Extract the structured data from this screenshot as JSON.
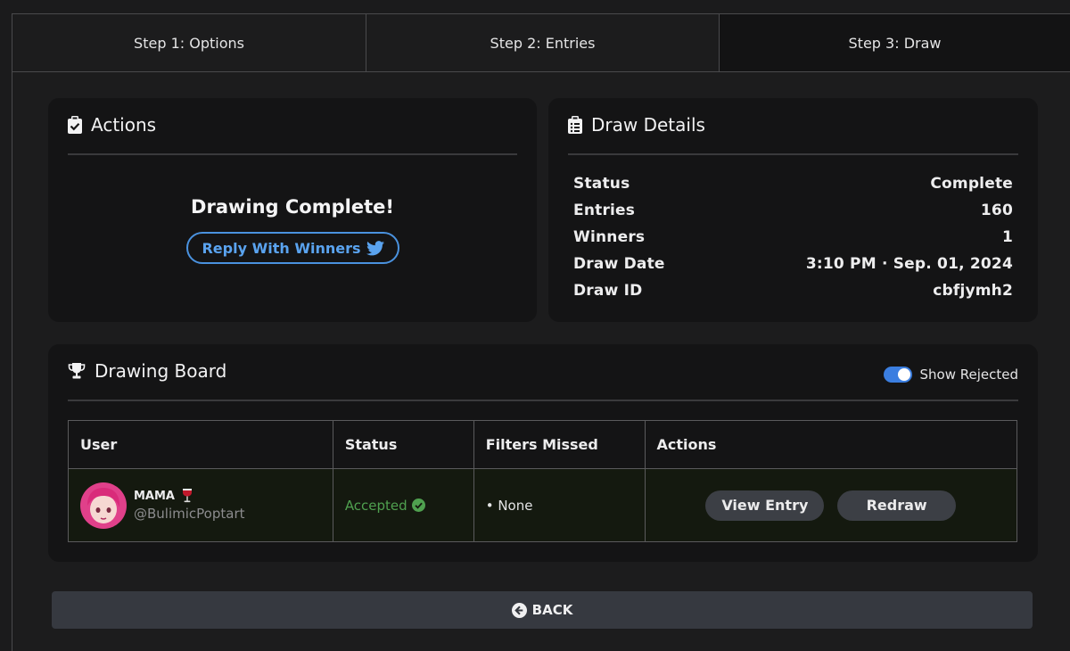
{
  "tabs": [
    {
      "label": "Step 1: Options"
    },
    {
      "label": "Step 2: Entries"
    },
    {
      "label": "Step 3: Draw"
    }
  ],
  "actions": {
    "title": "Actions",
    "message": "Drawing Complete!",
    "reply_label": "Reply With Winners"
  },
  "details": {
    "title": "Draw Details",
    "rows": [
      {
        "label": "Status",
        "value": "Complete"
      },
      {
        "label": "Entries",
        "value": "160"
      },
      {
        "label": "Winners",
        "value": "1"
      },
      {
        "label": "Draw Date",
        "value": "3:10 PM · Sep. 01, 2024"
      },
      {
        "label": "Draw ID",
        "value": "cbfjymh2"
      }
    ]
  },
  "board": {
    "title": "Drawing Board",
    "show_rejected_label": "Show Rejected",
    "show_rejected": true,
    "columns": [
      "User",
      "Status",
      "Filters Missed",
      "Actions"
    ],
    "rows": [
      {
        "name": "MAMA",
        "handle": "@BulimicPoptart",
        "status": "Accepted",
        "filters": "• None",
        "view_label": "View Entry",
        "redraw_label": "Redraw"
      }
    ]
  },
  "back_label": "BACK",
  "colors": {
    "accent": "#4a92df",
    "accepted": "#4fa04f",
    "toggle": "#3b7ee0"
  }
}
